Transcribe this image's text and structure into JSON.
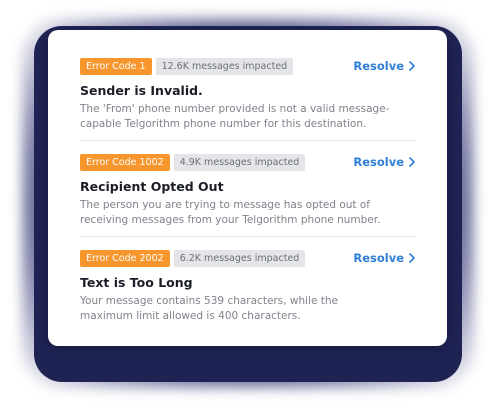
{
  "errors": [
    {
      "code_label": "Error Code 1",
      "impact": "12.6K messages impacted",
      "resolve_label": "Resolve",
      "title": "Sender is Invalid.",
      "description": "The 'From' phone number provided is not a valid message-capable Telgorithm phone number for this destination."
    },
    {
      "code_label": "Error Code 1002",
      "impact": "4.9K messages impacted",
      "resolve_label": "Resolve",
      "title": "Recipient Opted Out",
      "description": "The person you are trying to message has opted out of receiving messages from your Telgorithm phone number."
    },
    {
      "code_label": "Error Code 2002",
      "impact": "6.2K messages impacted",
      "resolve_label": "Resolve",
      "title": "Text is Too Long",
      "description": "Your message contains 539 characters, while the maximum limit allowed is 400 characters."
    }
  ],
  "colors": {
    "code_badge": "#f7962c",
    "resolve_link": "#2f7fd8",
    "background_frame": "#1f2354"
  },
  "icons": {
    "resolve": "chevron-right-icon"
  }
}
